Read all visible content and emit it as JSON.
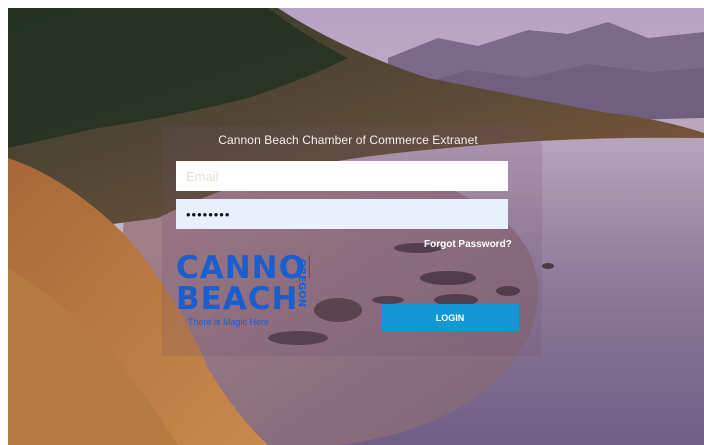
{
  "page": {
    "title": "Cannon Beach Chamber of Commerce Extranet"
  },
  "form": {
    "email_placeholder": "Email",
    "email_value": "",
    "password_value": "••••••••",
    "forgot_label": "Forgot Password?",
    "login_label": "LOGIN"
  },
  "logo": {
    "line1": "CANNON",
    "line2": "BEACH",
    "vertical": "OREGON",
    "tagline": "There is Magic Here"
  },
  "colors": {
    "button": "#1497d6",
    "logo": "#1a5fd0"
  }
}
